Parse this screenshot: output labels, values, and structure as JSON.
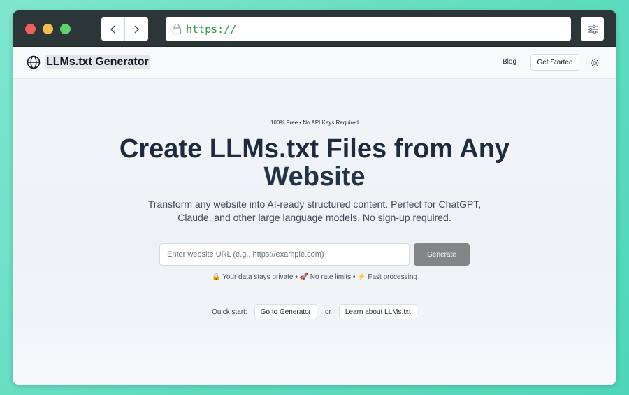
{
  "browser": {
    "url": "https://",
    "icons": {
      "back": "chevron-left-icon",
      "forward": "chevron-right-icon",
      "lock": "lock-icon",
      "menu": "sliders-icon"
    }
  },
  "site": {
    "brand": "LLMs.txt Generator",
    "nav": {
      "blog": "Blog",
      "get_started": "Get Started"
    }
  },
  "hero": {
    "tagline": "100% Free • No API Keys Required",
    "title_line1": "Create LLMs.txt Files from Any",
    "title_line2": "Website",
    "subtitle": "Transform any website into AI-ready structured content. Perfect for ChatGPT, Claude, and other large language models. No sign-up required.",
    "url_placeholder": "Enter website URL (e.g., https://example.com)",
    "generate_label": "Generate",
    "features": "🔒 Your data stays private • 🚀 No rate limits • ⚡ Fast processing",
    "quick_start": {
      "label": "Quick start:",
      "button1": "Go to Generator",
      "or": "or",
      "button2": "Learn about LLMs.txt"
    }
  },
  "colors": {
    "background": "#5fdcc0",
    "chrome": "#2c3638",
    "url_text": "#2e9b3e",
    "title": "#1e2a3e",
    "generate_button": "#848586"
  }
}
